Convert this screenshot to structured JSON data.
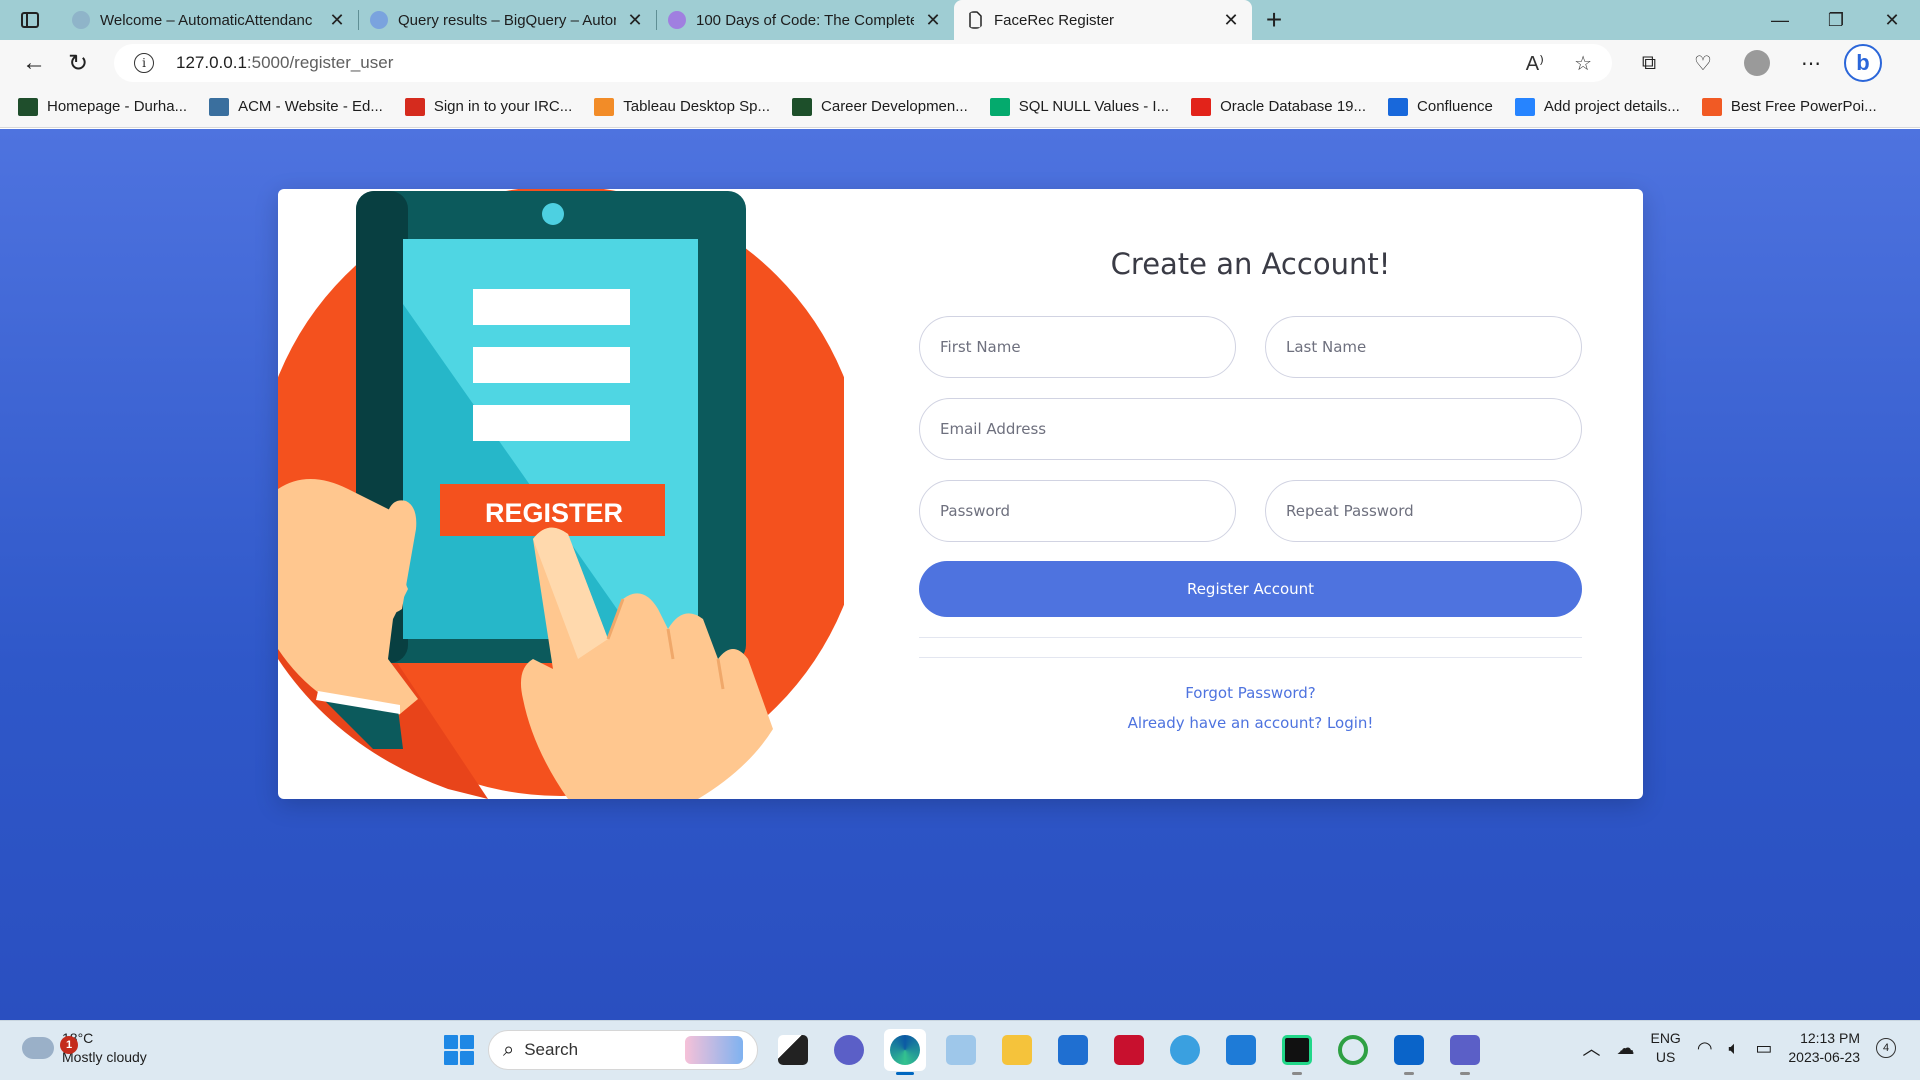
{
  "browser": {
    "tabs": [
      {
        "title": "Welcome – AutomaticAttendanc",
        "favicon_color": "#8fb4c9",
        "active": false
      },
      {
        "title": "Query results – BigQuery – Autor",
        "favicon_color": "#7aa3de",
        "active": false
      },
      {
        "title": "100 Days of Code: The Complete",
        "favicon_color": "#a07fe0",
        "active": false
      },
      {
        "title": "FaceRec Register",
        "favicon_color": "#ffffff",
        "active": true
      }
    ],
    "new_tab_label": "+",
    "url_host": "127.0.0.1",
    "url_path": ":5000/register_user",
    "bookmarks": [
      {
        "label": "Homepage - Durha...",
        "color": "#1f4e2c"
      },
      {
        "label": "ACM - Website - Ed...",
        "color": "#3a6f9e"
      },
      {
        "label": "Sign in to your IRC...",
        "color": "#d52b1e"
      },
      {
        "label": "Tableau Desktop Sp...",
        "color": "#f28c28"
      },
      {
        "label": "Career Developmen...",
        "color": "#1d4f2a"
      },
      {
        "label": "SQL NULL Values - I...",
        "color": "#04aa6d"
      },
      {
        "label": "Oracle Database 19...",
        "color": "#e2231a"
      },
      {
        "label": "Confluence",
        "color": "#1868db"
      },
      {
        "label": "Add project details...",
        "color": "#2684ff"
      },
      {
        "label": "Best Free PowerPoi...",
        "color": "#f15a24"
      }
    ]
  },
  "illustration": {
    "button_text": "REGISTER",
    "colors": {
      "circle": "#f4511e",
      "tablet": "#0c5a5c",
      "screen": "#4dd0e1",
      "skin": "#ffc78f"
    }
  },
  "form": {
    "title": "Create an Account!",
    "first_name_placeholder": "First Name",
    "last_name_placeholder": "Last Name",
    "email_placeholder": "Email Address",
    "password_placeholder": "Password",
    "repeat_password_placeholder": "Repeat Password",
    "submit_label": "Register Account",
    "forgot_password_link": "Forgot Password?",
    "login_link": "Already have an account? Login!",
    "accent_color": "#4e73df"
  },
  "taskbar": {
    "weather_temp": "18°C",
    "weather_desc": "Mostly cloudy",
    "weather_badge": "1",
    "search_label": "Search",
    "lang_top": "ENG",
    "lang_bottom": "US",
    "time": "12:13 PM",
    "date": "2023-06-23",
    "notification_count": "4"
  }
}
